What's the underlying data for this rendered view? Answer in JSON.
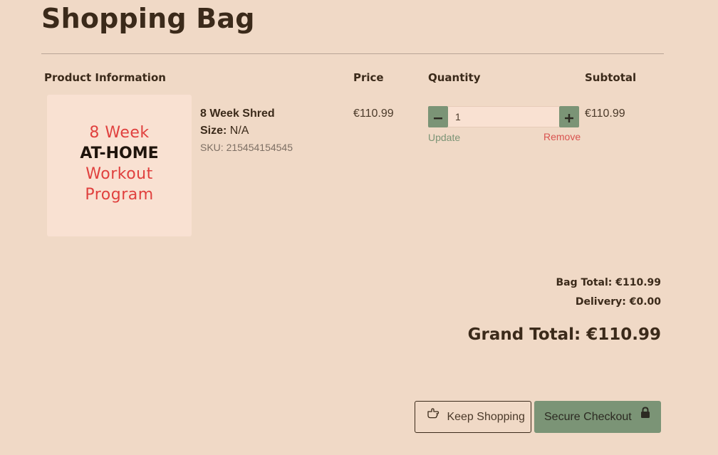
{
  "page": {
    "title": "Shopping Bag"
  },
  "table": {
    "headers": {
      "product_information": "Product Information",
      "price": "Price",
      "quantity": "Quantity",
      "subtotal": "Subtotal"
    }
  },
  "item": {
    "image_text": {
      "line1": "8 Week",
      "line2": "AT-HOME",
      "line3": "Workout",
      "line4": "Program"
    },
    "name": "8 Week Shred",
    "size_label": "Size:",
    "size_value": "N/A",
    "sku": "SKU: 215454154545",
    "price": "€110.99",
    "quantity": "1",
    "update_label": "Update",
    "remove_label": "Remove",
    "subtotal": "€110.99"
  },
  "totals": {
    "bag_total": "Bag Total: €110.99",
    "delivery": "Delivery: €0.00",
    "grand_total": "Grand Total: €110.99"
  },
  "actions": {
    "keep_shopping": "Keep Shopping",
    "secure_checkout": "Secure Checkout"
  },
  "icons": {
    "keep_shopping": "pointing-hand-icon",
    "secure_checkout": "lock-icon",
    "minus": "minus-icon",
    "plus": "plus-icon"
  },
  "colors": {
    "background": "#f0d9c6",
    "accent_green": "#7b9476",
    "remove_red": "#d9534f",
    "text_dark": "#3b2a1a"
  }
}
